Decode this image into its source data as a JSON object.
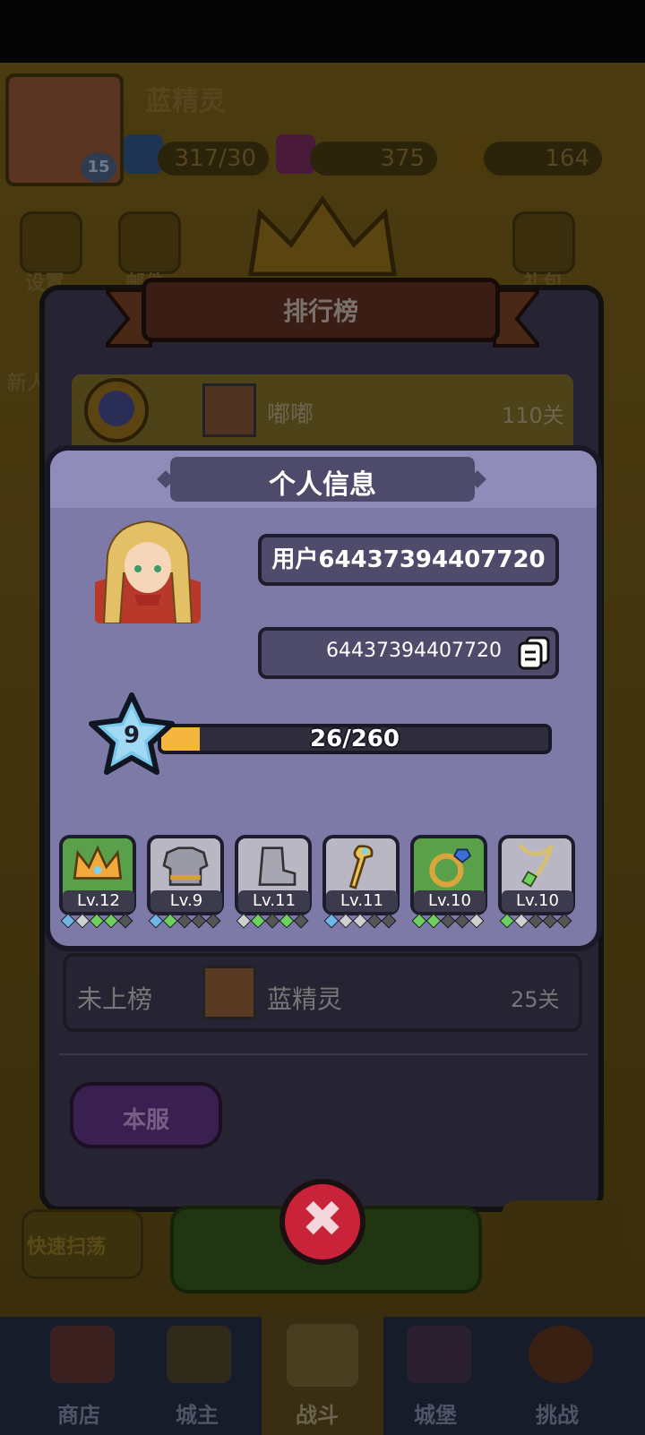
{
  "top": {
    "player_name": "蓝精灵",
    "player_level": "15",
    "energy": "317/30",
    "gems": "375",
    "coins": "164",
    "menu": [
      "设置",
      "邮件",
      "礼包",
      "新人"
    ]
  },
  "ranking": {
    "title": "排行榜",
    "row1": {
      "name": "嘟嘟",
      "value": "110关"
    },
    "self": {
      "position": "未上榜",
      "name": "蓝精灵",
      "value": "25关"
    },
    "server_tab": "本服"
  },
  "profile": {
    "title": "个人信息",
    "username": "用户64437394407720",
    "uid": "64437394407720",
    "level": "9",
    "xp_text": "26/260",
    "xp_fraction": 0.1,
    "equipment": [
      {
        "name": "crown",
        "level": "Lv.12",
        "bg": "green",
        "dots": [
          "#6fb6e6",
          "#cfcfcf",
          "#6fcf5f",
          "#6fcf5f",
          "#555"
        ]
      },
      {
        "name": "armor",
        "level": "Lv.9",
        "bg": "gray",
        "dots": [
          "#6fb6e6",
          "#6fcf5f",
          "#555",
          "#555",
          "#555"
        ]
      },
      {
        "name": "boots",
        "level": "Lv.11",
        "bg": "gray",
        "dots": [
          "#cfcfcf",
          "#6fcf5f",
          "#555",
          "#6fcf5f",
          "#555"
        ]
      },
      {
        "name": "staff",
        "level": "Lv.11",
        "bg": "gray",
        "dots": [
          "#6fb6e6",
          "#cfcfcf",
          "#cfcfcf",
          "#555",
          "#555"
        ]
      },
      {
        "name": "ring",
        "level": "Lv.10",
        "bg": "green",
        "dots": [
          "#6fcf5f",
          "#6fcf5f",
          "#555",
          "#555",
          "#cfcfcf"
        ]
      },
      {
        "name": "amulet",
        "level": "Lv.10",
        "bg": "gray",
        "dots": [
          "#6fcf5f",
          "#cfcfcf",
          "#555",
          "#555",
          "#555"
        ]
      }
    ]
  },
  "bottom_nav": [
    "商店",
    "城主",
    "战斗",
    "城堡",
    "挑战"
  ],
  "quick_sweep": "快速扫荡",
  "colors": {
    "accent": "#f4b63f",
    "dialog": "#7d7aa8",
    "close": "#c9233a"
  }
}
